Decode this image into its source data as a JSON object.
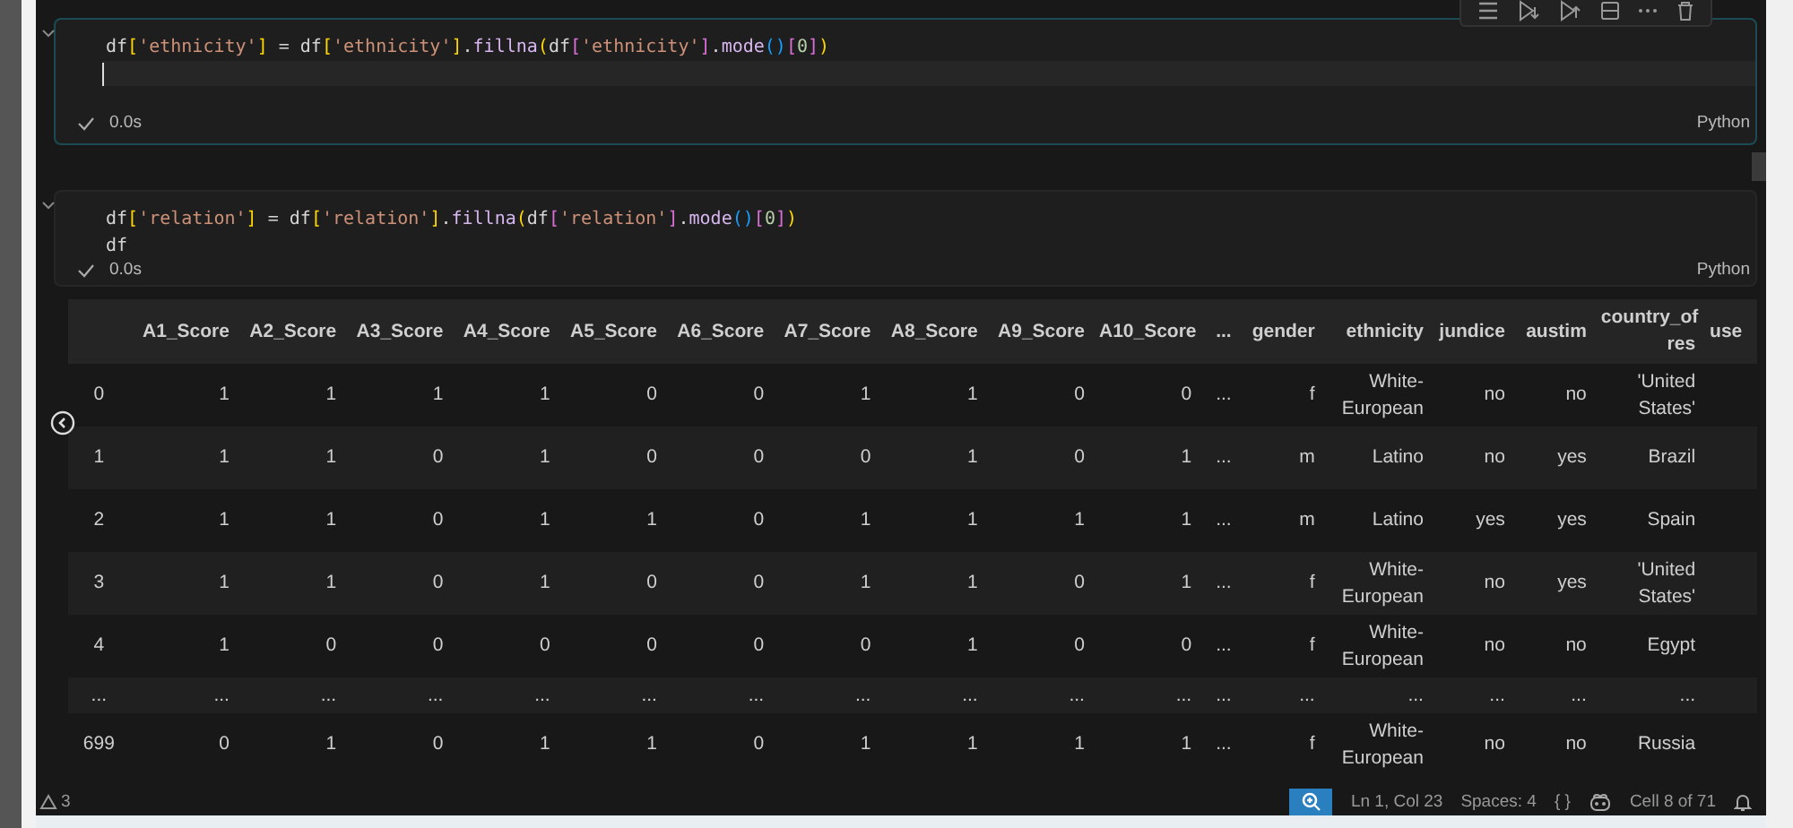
{
  "cells": [
    {
      "focused": true,
      "cursor_line": true,
      "lines": [
        [
          {
            "text": "df",
            "kind": "var"
          },
          {
            "text": "[",
            "kind": "br1"
          },
          {
            "text": "'ethnicity'",
            "kind": "str"
          },
          {
            "text": "]",
            "kind": "br1"
          },
          {
            "text": " = ",
            "kind": "op"
          },
          {
            "text": "df",
            "kind": "var"
          },
          {
            "text": "[",
            "kind": "br1"
          },
          {
            "text": "'ethnicity'",
            "kind": "str"
          },
          {
            "text": "]",
            "kind": "br1"
          },
          {
            "text": ".",
            "kind": "op"
          },
          {
            "text": "fillna",
            "kind": "fn"
          },
          {
            "text": "(",
            "kind": "br1"
          },
          {
            "text": "df",
            "kind": "var"
          },
          {
            "text": "[",
            "kind": "br2"
          },
          {
            "text": "'ethnicity'",
            "kind": "str"
          },
          {
            "text": "]",
            "kind": "br2"
          },
          {
            "text": ".",
            "kind": "op"
          },
          {
            "text": "mode",
            "kind": "fn"
          },
          {
            "text": "()",
            "kind": "br3"
          },
          {
            "text": "[",
            "kind": "br2"
          },
          {
            "text": "0",
            "kind": "num"
          },
          {
            "text": "]",
            "kind": "br2"
          },
          {
            "text": ")",
            "kind": "br1"
          }
        ]
      ],
      "succeeded": true,
      "time": "0.0s",
      "language": "Python"
    },
    {
      "focused": false,
      "cursor_line": false,
      "lines": [
        [
          {
            "text": "df",
            "kind": "var"
          },
          {
            "text": "[",
            "kind": "br1"
          },
          {
            "text": "'relation'",
            "kind": "str"
          },
          {
            "text": "]",
            "kind": "br1"
          },
          {
            "text": " = ",
            "kind": "op"
          },
          {
            "text": "df",
            "kind": "var"
          },
          {
            "text": "[",
            "kind": "br1"
          },
          {
            "text": "'relation'",
            "kind": "str"
          },
          {
            "text": "]",
            "kind": "br1"
          },
          {
            "text": ".",
            "kind": "op"
          },
          {
            "text": "fillna",
            "kind": "fn"
          },
          {
            "text": "(",
            "kind": "br1"
          },
          {
            "text": "df",
            "kind": "var"
          },
          {
            "text": "[",
            "kind": "br2"
          },
          {
            "text": "'relation'",
            "kind": "str"
          },
          {
            "text": "]",
            "kind": "br2"
          },
          {
            "text": ".",
            "kind": "op"
          },
          {
            "text": "mode",
            "kind": "fn"
          },
          {
            "text": "()",
            "kind": "br3"
          },
          {
            "text": "[",
            "kind": "br2"
          },
          {
            "text": "0",
            "kind": "num"
          },
          {
            "text": "]",
            "kind": "br2"
          },
          {
            "text": ")",
            "kind": "br1"
          }
        ],
        [
          {
            "text": "df",
            "kind": "var"
          }
        ]
      ],
      "succeeded": true,
      "time": "0.0s",
      "language": "Python"
    }
  ],
  "table": {
    "columns": [
      "",
      "A1_Score",
      "A2_Score",
      "A3_Score",
      "A4_Score",
      "A5_Score",
      "A6_Score",
      "A7_Score",
      "A8_Score",
      "A9_Score",
      "A10_Score",
      "...",
      "gender",
      "ethnicity",
      "jundice",
      "austim",
      "country_of res",
      "use"
    ],
    "rows": [
      [
        "0",
        "1",
        "1",
        "1",
        "1",
        "0",
        "0",
        "1",
        "1",
        "0",
        "0",
        "...",
        "f",
        "White-European",
        "no",
        "no",
        "'United States'",
        ""
      ],
      [
        "1",
        "1",
        "1",
        "0",
        "1",
        "0",
        "0",
        "0",
        "1",
        "0",
        "1",
        "...",
        "m",
        "Latino",
        "no",
        "yes",
        "Brazil",
        ""
      ],
      [
        "2",
        "1",
        "1",
        "0",
        "1",
        "1",
        "0",
        "1",
        "1",
        "1",
        "1",
        "...",
        "m",
        "Latino",
        "yes",
        "yes",
        "Spain",
        ""
      ],
      [
        "3",
        "1",
        "1",
        "0",
        "1",
        "0",
        "0",
        "1",
        "1",
        "0",
        "1",
        "...",
        "f",
        "White-European",
        "no",
        "yes",
        "'United States'",
        ""
      ],
      [
        "4",
        "1",
        "0",
        "0",
        "0",
        "0",
        "0",
        "0",
        "1",
        "0",
        "0",
        "...",
        "f",
        "White-European",
        "no",
        "no",
        "Egypt",
        ""
      ],
      [
        "...",
        "...",
        "...",
        "...",
        "...",
        "...",
        "...",
        "...",
        "...",
        "...",
        "...",
        "...",
        "...",
        "...",
        "...",
        "...",
        "...",
        ""
      ],
      [
        "699",
        "0",
        "1",
        "0",
        "1",
        "1",
        "0",
        "1",
        "1",
        "1",
        "1",
        "...",
        "f",
        "White-European",
        "no",
        "no",
        "Russia",
        ""
      ]
    ]
  },
  "status_bar": {
    "warnings": "3",
    "position": "Ln 1, Col 23",
    "spaces": "Spaces: 4",
    "braces": "{ }",
    "cell": "Cell 8 of 71"
  }
}
